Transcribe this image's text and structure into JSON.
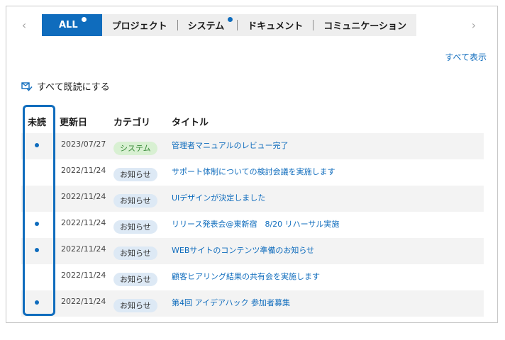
{
  "tabs": {
    "prev_arrow": "‹",
    "next_arrow": "›",
    "items": [
      {
        "label": "ALL",
        "active": true,
        "badge": true
      },
      {
        "label": "プロジェクト",
        "active": false,
        "badge": false
      },
      {
        "label": "システム",
        "active": false,
        "badge": true
      },
      {
        "label": "ドキュメント",
        "active": false,
        "badge": false
      },
      {
        "label": "コミュニケーション",
        "active": false,
        "badge": false
      }
    ]
  },
  "show_all": "すべて表示",
  "mark_all_read": "すべて既読にする",
  "table": {
    "headers": {
      "unread": "未読",
      "date": "更新日",
      "category": "カテゴリ",
      "title": "タイトル"
    },
    "rows": [
      {
        "unread": true,
        "date": "2023/07/27",
        "category": "システム",
        "cat_type": "system",
        "title": "管理者マニュアルのレビュー完了"
      },
      {
        "unread": false,
        "date": "2022/11/24",
        "category": "お知らせ",
        "cat_type": "notice",
        "title": "サポート体制についての検討会議を実施します"
      },
      {
        "unread": false,
        "date": "2022/11/24",
        "category": "お知らせ",
        "cat_type": "notice",
        "title": "UIデザインが決定しました"
      },
      {
        "unread": true,
        "date": "2022/11/24",
        "category": "お知らせ",
        "cat_type": "notice",
        "title": "リリース発表会@東新宿　8/20 リハーサル実施"
      },
      {
        "unread": true,
        "date": "2022/11/24",
        "category": "お知らせ",
        "cat_type": "notice",
        "title": "WEBサイトのコンテンツ準備のお知らせ"
      },
      {
        "unread": false,
        "date": "2022/11/24",
        "category": "お知らせ",
        "cat_type": "notice",
        "title": "顧客ヒアリング結果の共有会を実施します"
      },
      {
        "unread": true,
        "date": "2022/11/24",
        "category": "お知らせ",
        "cat_type": "notice",
        "title": "第4回 アイデアハック 参加者募集"
      }
    ]
  },
  "colors": {
    "accent": "#0f6cbd",
    "system_badge_bg": "#d8f0d2",
    "notice_badge_bg": "#dde9f5"
  }
}
